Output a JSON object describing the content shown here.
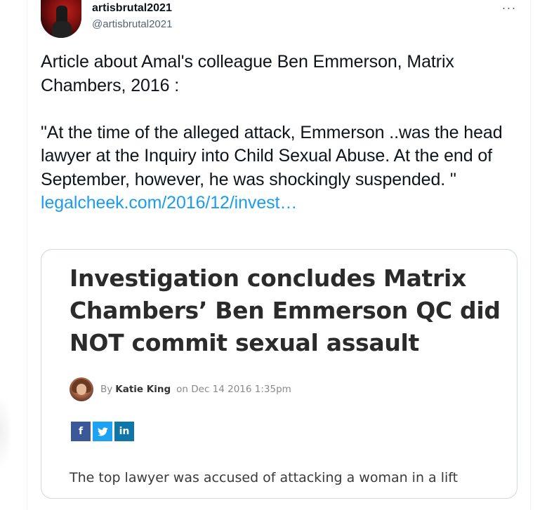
{
  "tweet": {
    "display_name": "artisbrutal2021",
    "handle": "@artisbrutal2021",
    "more_label": "···",
    "text": "Article about Amal's colleague Ben Emmerson, Matrix Chambers, 2016 :\n\n\"At the time of the alleged attack, Emmerson ..was the head lawyer at the Inquiry into Child Sexual Abuse. At the end of September, however, he was shockingly suspended. \"",
    "link_text": "legalcheek.com/2016/12/invest…"
  },
  "card": {
    "headline": "Investigation concludes Matrix Chambers’ Ben Emmerson QC did NOT commit sexual assault",
    "byline_prefix": "By",
    "author": "Katie King",
    "date_text": "on Dec 14 2016 1:35pm",
    "social": {
      "facebook_label": "f",
      "twitter_label": "🐦",
      "linkedin_label": "in"
    },
    "subtitle": "The top lawyer was accused of attacking a woman in a lift"
  },
  "colors": {
    "link": "#1d9bf0",
    "text": "#0f1419",
    "muted": "#536471",
    "facebook": "#3b5998",
    "twitter": "#1da1f2",
    "linkedin": "#0e76a8"
  }
}
